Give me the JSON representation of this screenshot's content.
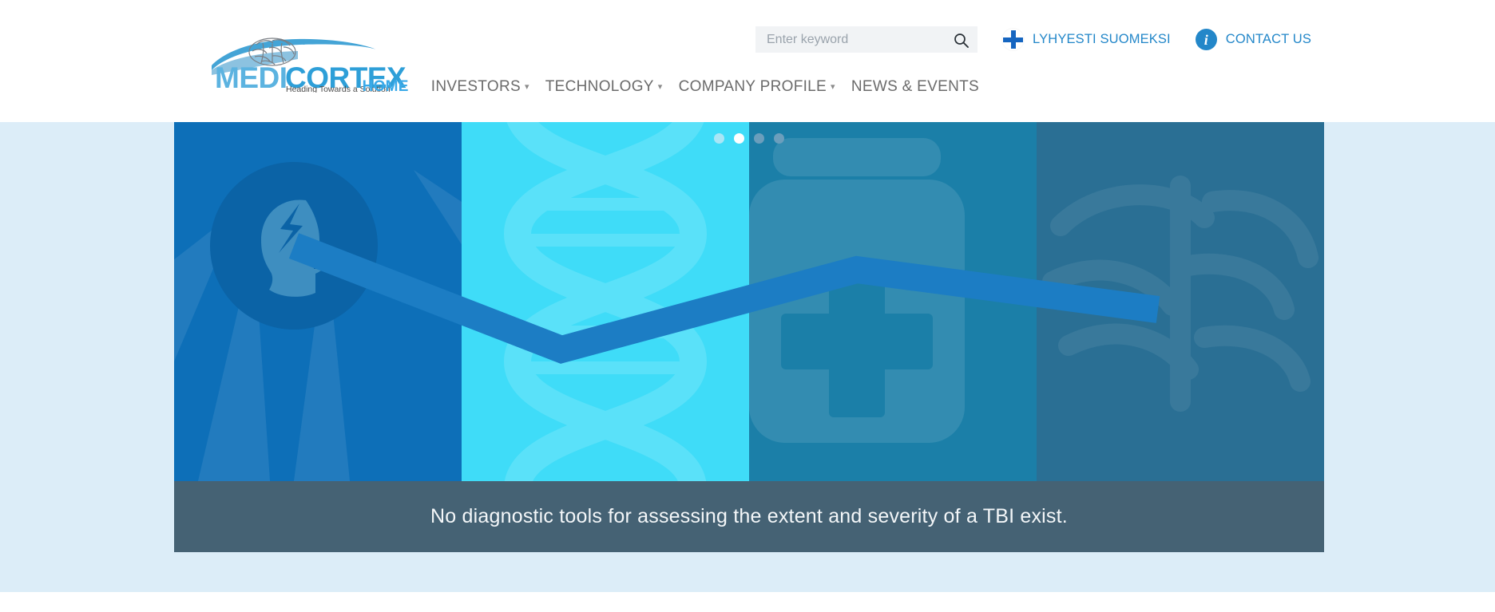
{
  "brand": {
    "name_part1": "MEDI",
    "name_part2": "CORTEX",
    "tagline": "Heading Towards a Solution",
    "logo_color_dark": "#2e9fd8",
    "logo_color_light": "#6ec3e8"
  },
  "search": {
    "placeholder": "Enter keyword",
    "value": "",
    "icon": "search-icon"
  },
  "utility": {
    "language_link": "LYHYESTI SUOMEKSI",
    "language_icon": "finnish-flag-cross-icon",
    "contact_link": "CONTACT US",
    "contact_icon": "info-circle-icon",
    "link_color": "#2387c9"
  },
  "nav": {
    "items": [
      {
        "label": "HOME",
        "active": true,
        "has_dropdown": false
      },
      {
        "label": "INVESTORS",
        "active": false,
        "has_dropdown": true
      },
      {
        "label": "TECHNOLOGY",
        "active": false,
        "has_dropdown": true
      },
      {
        "label": "COMPANY PROFILE",
        "active": false,
        "has_dropdown": true
      },
      {
        "label": "NEWS & EVENTS",
        "active": false,
        "has_dropdown": false
      }
    ],
    "active_color": "#3aa9e8",
    "inactive_color": "#6b6b6b",
    "chevron_icon": "chevron-down-icon"
  },
  "hero": {
    "caption": "No diagnostic tools for assessing the extent and severity of a TBI exist.",
    "caption_bg": "#456274",
    "page_bg": "#dcedf8",
    "panels": [
      {
        "name": "injury-panel",
        "bg": "#0d6fb8",
        "icon": "head-with-lightning-bolt-icon",
        "watermark": "rays-watermark"
      },
      {
        "name": "research-panel",
        "bg": "#3fdcf8",
        "icon": "microscope-icon",
        "watermark": "dna-helix-watermark"
      },
      {
        "name": "treatment-panel",
        "bg": "#1b7fa8",
        "icon": "medicine-bottle-and-head-icon",
        "watermark": "medical-cross-watermark"
      },
      {
        "name": "recovery-panel",
        "bg": "#2a6f94",
        "icon": "head-with-heart-icon",
        "watermark": "brain-watermark"
      }
    ],
    "carousel": {
      "slide_count": 4,
      "active_index": 1,
      "dots": [
        "inactive",
        "active",
        "inactive-dark",
        "inactive-dark"
      ]
    }
  }
}
